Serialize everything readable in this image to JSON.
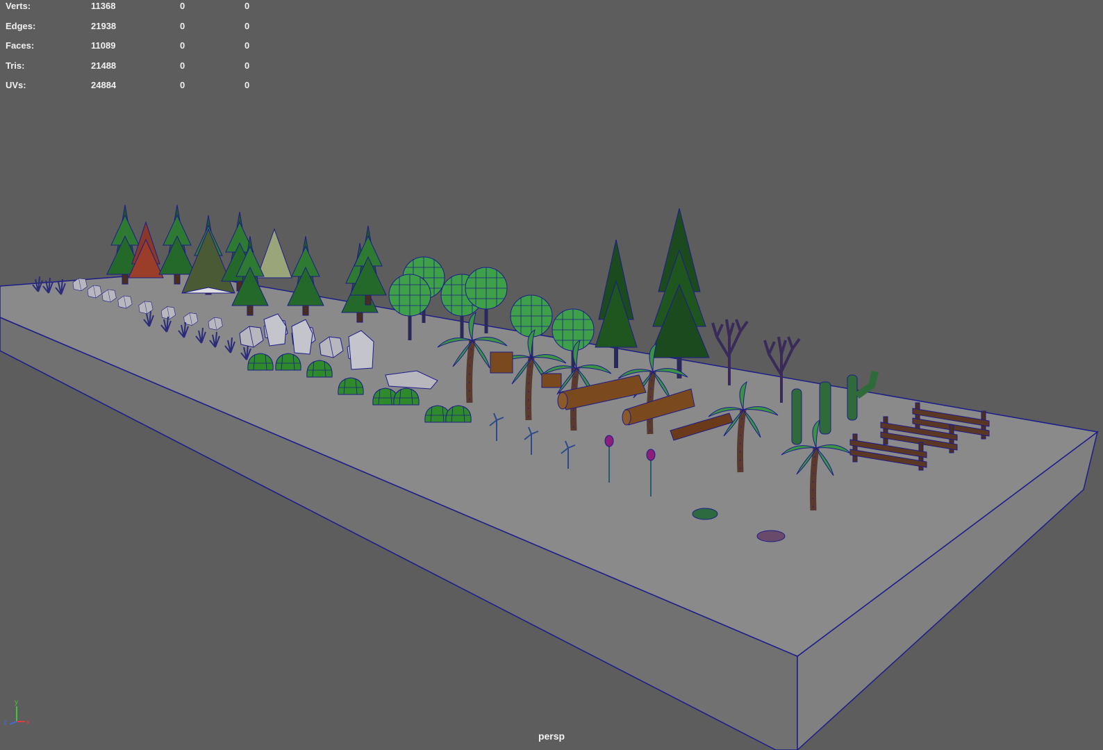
{
  "viewport": {
    "camera": "persp",
    "background": "#5d5d5d",
    "wireframe_color": "#1c1c8a"
  },
  "hud": {
    "stats": [
      {
        "label": "Verts:",
        "values": [
          "11368",
          "0",
          "0"
        ]
      },
      {
        "label": "Edges:",
        "values": [
          "21938",
          "0",
          "0"
        ]
      },
      {
        "label": "Faces:",
        "values": [
          "11089",
          "0",
          "0"
        ]
      },
      {
        "label": "Tris:",
        "values": [
          "21488",
          "0",
          "0"
        ]
      },
      {
        "label": "UVs:",
        "values": [
          "24884",
          "0",
          "0"
        ]
      }
    ]
  },
  "axis_gizmo": {
    "x": "x",
    "y": "y",
    "z": "z"
  }
}
